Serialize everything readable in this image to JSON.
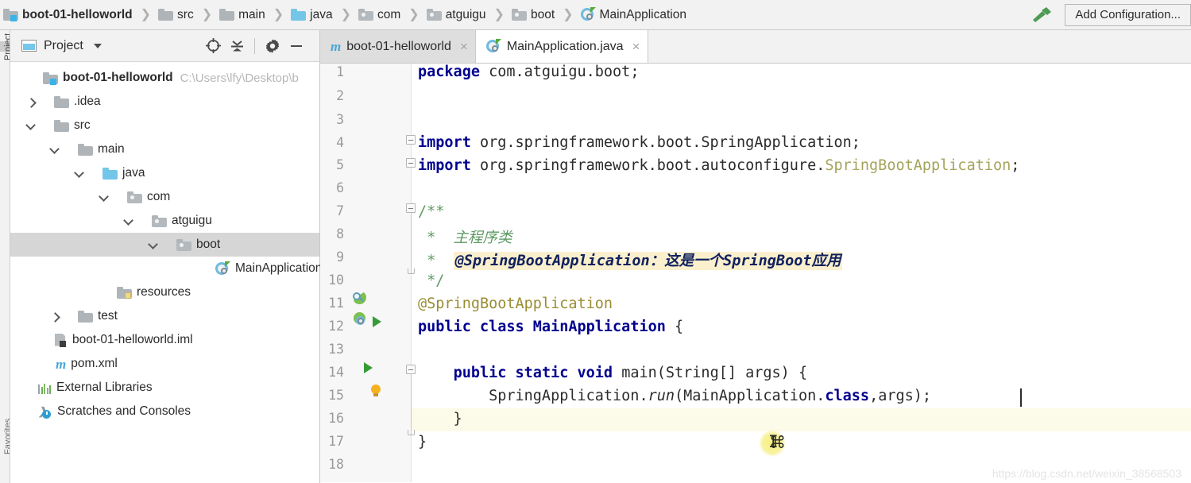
{
  "navbar": {
    "breadcrumbs": [
      {
        "label": "boot-01-helloworld",
        "icon": "module-folder-icon"
      },
      {
        "label": "src",
        "icon": "folder-icon"
      },
      {
        "label": "main",
        "icon": "folder-icon"
      },
      {
        "label": "java",
        "icon": "source-root-folder-icon"
      },
      {
        "label": "com",
        "icon": "package-folder-icon"
      },
      {
        "label": "atguigu",
        "icon": "package-folder-icon"
      },
      {
        "label": "boot",
        "icon": "package-folder-icon"
      },
      {
        "label": "MainApplication",
        "icon": "spring-boot-class-icon"
      }
    ],
    "build_icon": "hammer-icon",
    "add_configuration_label": "Add Configuration..."
  },
  "left_strip": {
    "tab_label": "Project",
    "bottom_label": "Favorites"
  },
  "project_panel": {
    "title": "Project",
    "window_icon": "project-window-icon",
    "dropdown_icon": "chevron-down-icon",
    "tools": [
      {
        "name": "locate-icon"
      },
      {
        "name": "collapse-all-icon"
      },
      {
        "name": "gear-icon"
      },
      {
        "name": "minimize-icon"
      }
    ],
    "tree": [
      {
        "label": "boot-01-helloworld",
        "path": "C:\\Users\\lfy\\Desktop\\b",
        "depth": 0,
        "arrow": "none",
        "icon": "module-folder-icon",
        "bold": true,
        "selected": false
      },
      {
        "label": ".idea",
        "path": "",
        "depth": 1,
        "arrow": "collapsed",
        "icon": "folder-icon",
        "bold": false,
        "selected": false
      },
      {
        "label": "src",
        "path": "",
        "depth": 1,
        "arrow": "expanded",
        "icon": "folder-icon",
        "bold": false,
        "selected": false
      },
      {
        "label": "main",
        "path": "",
        "depth": 2,
        "arrow": "expanded",
        "icon": "folder-icon",
        "bold": false,
        "selected": false
      },
      {
        "label": "java",
        "path": "",
        "depth": 3,
        "arrow": "expanded",
        "icon": "source-root-folder-icon",
        "bold": false,
        "selected": false
      },
      {
        "label": "com",
        "path": "",
        "depth": 4,
        "arrow": "expanded",
        "icon": "package-folder-icon",
        "bold": false,
        "selected": false
      },
      {
        "label": "atguigu",
        "path": "",
        "depth": 5,
        "arrow": "expanded",
        "icon": "package-folder-icon",
        "bold": false,
        "selected": false
      },
      {
        "label": "boot",
        "path": "",
        "depth": 6,
        "arrow": "expanded",
        "icon": "package-folder-icon",
        "bold": false,
        "selected": true
      },
      {
        "label": "MainApplication",
        "path": "",
        "depth": 7,
        "arrow": "none",
        "icon": "spring-boot-class-icon",
        "bold": false,
        "selected": false
      },
      {
        "label": "resources",
        "path": "",
        "depth": 3,
        "arrow": "none",
        "icon": "resources-folder-icon",
        "bold": false,
        "selected": false
      },
      {
        "label": "test",
        "path": "",
        "depth": 2,
        "arrow": "collapsed",
        "icon": "folder-icon",
        "bold": false,
        "selected": false
      },
      {
        "label": "boot-01-helloworld.iml",
        "path": "",
        "depth": 1,
        "arrow": "none",
        "icon": "iml-file-icon",
        "bold": false,
        "selected": false
      },
      {
        "label": "pom.xml",
        "path": "",
        "depth": 1,
        "arrow": "none",
        "icon": "maven-icon",
        "bold": false,
        "selected": false
      },
      {
        "label": "External Libraries",
        "path": "",
        "depth": 0,
        "arrow": "none",
        "icon": "libraries-icon",
        "bold": false,
        "selected": false
      },
      {
        "label": "Scratches and Consoles",
        "path": "",
        "depth": 0,
        "arrow": "none",
        "icon": "scratches-icon",
        "bold": false,
        "selected": false
      }
    ]
  },
  "editor": {
    "tabs": [
      {
        "label": "boot-01-helloworld",
        "icon": "maven-icon",
        "active": false,
        "close_icon": "×"
      },
      {
        "label": "MainApplication.java",
        "icon": "spring-boot-class-icon",
        "active": true,
        "close_icon": "×"
      }
    ],
    "line_numbers": [
      "1",
      "2",
      "3",
      "4",
      "5",
      "6",
      "7",
      "8",
      "9",
      "10",
      "11",
      "12",
      "13",
      "14",
      "15",
      "16",
      "17",
      "18"
    ],
    "current_line": 15,
    "code": {
      "l1": "package com.atguigu.boot;",
      "l4": "import org.springframework.boot.SpringApplication;",
      "l5a": "import org.springframework.boot.autoconfigure.",
      "l5b": "SpringBootApplication",
      "l5c": ";",
      "l7": "/**",
      "l8": " *  主程序类",
      "l9pre": " *  ",
      "l9hl": "@SpringBootApplication：这是一个SpringBoot应用",
      "l10": " */",
      "l11": "@SpringBootApplication",
      "l12a": "public class ",
      "l12b": "MainApplication",
      "l12c": " {",
      "l14a": "    public static void ",
      "l14b": "main(String[] args) {",
      "l15a": "        SpringApplication.",
      "l15b": "run",
      "l15c": "(MainApplication.",
      "l15d": "class",
      "l15e": ",args);",
      "l16": "    }",
      "l17": "}"
    },
    "gutter_icons": [
      {
        "line": 11,
        "name": "spring-bean-gutter-icon"
      },
      {
        "line": 12,
        "name": "spring-boot-gutter-icon"
      },
      {
        "line": 12,
        "name": "run-gutter-icon"
      },
      {
        "line": 14,
        "name": "run-gutter-icon"
      },
      {
        "line": 15,
        "name": "intention-bulb-icon"
      }
    ],
    "watermark": "https://blog.csdn.net/weixin_38568503"
  },
  "colors": {
    "keyword": "#00008f",
    "comment": "#5d9a63",
    "highlight_bg": "#faf0cd",
    "current_line_bg": "#fcfae8",
    "selection_row_bg": "#d6d6d6",
    "accent_blue": "#74c6e8",
    "accent_green": "#369b36",
    "chrome_bg": "#f2f2f2"
  }
}
